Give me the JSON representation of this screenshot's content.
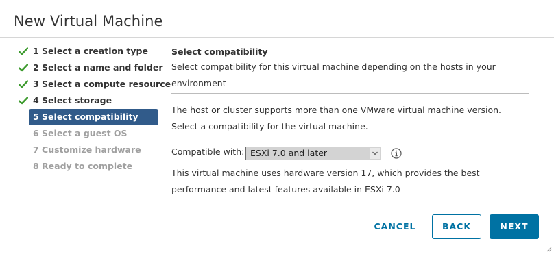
{
  "dialog": {
    "title": "New Virtual Machine"
  },
  "steps": [
    {
      "label": "1 Select a creation type",
      "state": "done"
    },
    {
      "label": "2 Select a name and folder",
      "state": "done"
    },
    {
      "label": "3 Select a compute resource",
      "state": "done"
    },
    {
      "label": "4 Select storage",
      "state": "done"
    },
    {
      "label": "5 Select compatibility",
      "state": "current"
    },
    {
      "label": "6 Select a guest OS",
      "state": "pending"
    },
    {
      "label": "7 Customize hardware",
      "state": "pending"
    },
    {
      "label": "8 Ready to complete",
      "state": "pending"
    }
  ],
  "main": {
    "heading": "Select compatibility",
    "description": "Select compatibility for this virtual machine depending on the hosts in your environment",
    "intro": "The host or cluster supports more than one VMware virtual machine version. Select a compatibility for the virtual machine.",
    "compat_label": "Compatible with:",
    "compat_value": "ESXi 7.0 and later",
    "outcome": "This virtual machine uses hardware version 17, which provides the best performance and latest features available in ESXi 7.0"
  },
  "footer": {
    "cancel_label": "CANCEL",
    "back_label": "BACK",
    "next_label": "NEXT"
  },
  "colors": {
    "accent": "#0072a3",
    "current_step_bg": "#315b8a",
    "check_green": "#3c9a2d",
    "pending_text": "#a0a0a0"
  },
  "icons": {
    "done_step": "check-icon",
    "compat_help": "info-icon",
    "dropdown": "chevron-down-icon",
    "window_resize": "resize-grip-icon"
  }
}
